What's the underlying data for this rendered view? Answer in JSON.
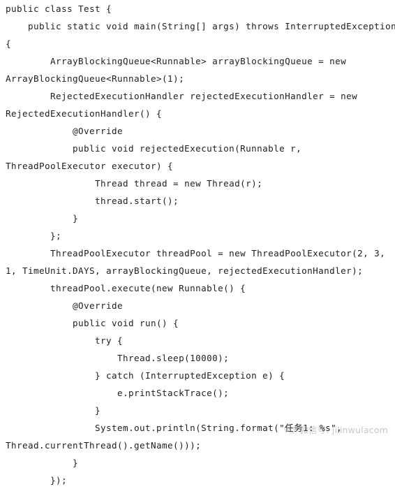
{
  "document": {
    "type": "code-listing",
    "language": "Java",
    "background_color": "#ffffff",
    "text_color": "#1e1e1e"
  },
  "code": {
    "lines": [
      "public class Test {",
      "    public static void main(String[] args) throws InterruptedException",
      "{",
      "        ArrayBlockingQueue<Runnable> arrayBlockingQueue = new",
      "ArrayBlockingQueue<Runnable>(1);",
      "        RejectedExecutionHandler rejectedExecutionHandler = new",
      "RejectedExecutionHandler() {",
      "            @Override",
      "            public void rejectedExecution(Runnable r,",
      "ThreadPoolExecutor executor) {",
      "                Thread thread = new Thread(r);",
      "                thread.start();",
      "            }",
      "        };",
      "        ThreadPoolExecutor threadPool = new ThreadPoolExecutor(2, 3,",
      "1, TimeUnit.DAYS, arrayBlockingQueue, rejectedExecutionHandler);",
      "        threadPool.execute(new Runnable() {",
      "            @Override",
      "            public void run() {",
      "                try {",
      "                    Thread.sleep(10000);",
      "                } catch (InterruptedException e) {",
      "                    e.printStackTrace();",
      "                }",
      "                System.out.println(String.format(\"任务1: %s\",",
      "Thread.currentThread().getName()));",
      "            }",
      "        });"
    ]
  },
  "watermark": {
    "icon": "wechat-logo-icon",
    "text": "微信号: jilinwulacom",
    "color": "#7a7a7a"
  }
}
